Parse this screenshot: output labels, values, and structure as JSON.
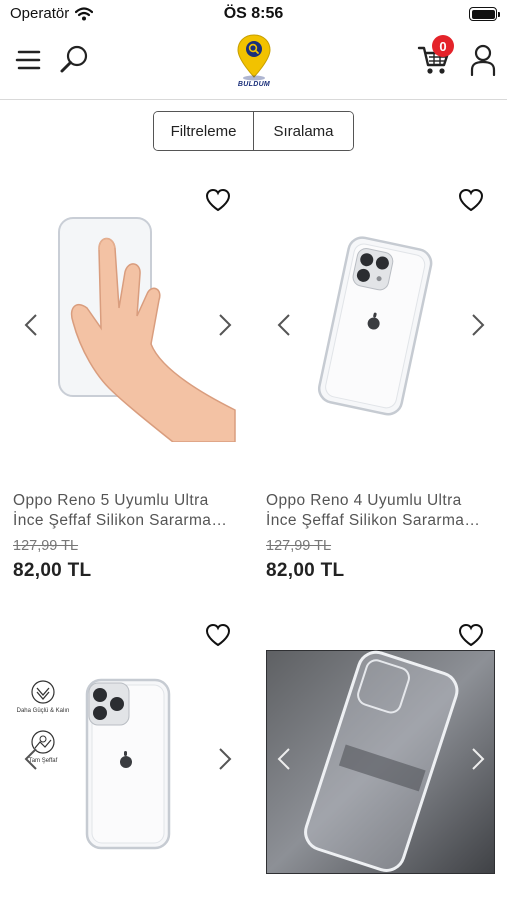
{
  "status_bar": {
    "carrier": "Operatör",
    "time": "ÖS 8:56"
  },
  "header": {
    "logo_text": "BULDUM",
    "cart_count": "0"
  },
  "controls": {
    "filter_label": "Filtreleme",
    "sort_label": "Sıralama"
  },
  "products": [
    {
      "title_line1": "Oppo Reno 5 Uyumlu Ultra",
      "title_line2": "İnce Şeffaf Silikon Sararma…",
      "old_price": "127,99 TL",
      "price": "82,00 TL"
    },
    {
      "title_line1": "Oppo Reno 4 Uyumlu Ultra",
      "title_line2": "İnce Şeffaf Silikon Sararma…",
      "old_price": "127,99 TL",
      "price": "82,00 TL"
    },
    {
      "badge_1": "Daha Güçlü & Kalın",
      "badge_2": "Tam Şeffaf"
    },
    {}
  ],
  "colors": {
    "badge_red": "#e4232a",
    "logo_yellow": "#f2c200",
    "logo_blue": "#1a2f7a",
    "divider": "#d9d9d9"
  }
}
